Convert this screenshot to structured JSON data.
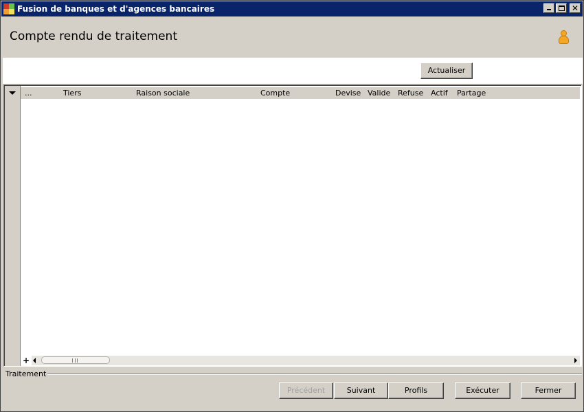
{
  "window": {
    "title": "Fusion de banques et d'agences bancaires"
  },
  "header": {
    "title": "Compte rendu de traitement"
  },
  "toolbar": {
    "refresh_label": "Actualiser"
  },
  "grid": {
    "columns": [
      "...",
      "Tiers",
      "Raison sociale",
      "Compte",
      "Devise",
      "Valide",
      "Refuse",
      "Actif",
      "Partage"
    ],
    "rows": []
  },
  "footer": {
    "group_label": "Traitement",
    "buttons": {
      "previous": "Précédent",
      "next": "Suivant",
      "profiles": "Profils",
      "execute": "Exécuter",
      "close": "Fermer"
    }
  },
  "icons": {
    "app": "app-icon",
    "user": "user-icon",
    "minimize": "minimize-icon",
    "maximize": "maximize-icon",
    "close": "close-icon",
    "dropdown": "chevron-down-icon",
    "add": "plus-icon"
  },
  "colors": {
    "titlebar": "#0a246a",
    "window": "#d4d0c8",
    "user_icon": "#f5a623"
  }
}
